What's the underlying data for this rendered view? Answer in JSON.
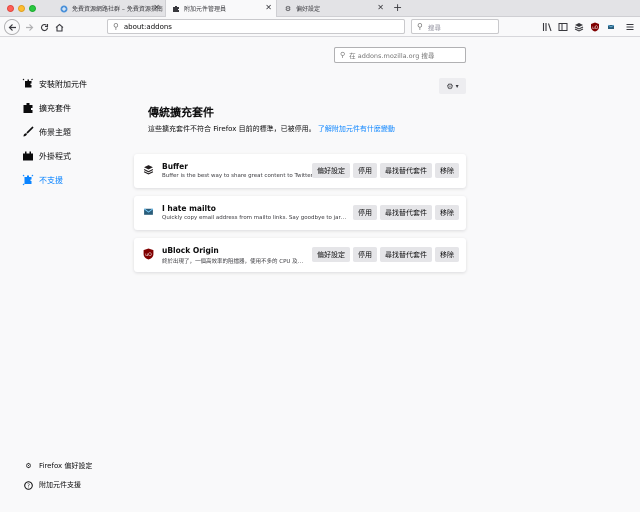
{
  "tabs": [
    {
      "label": "免費資源網路社群 – 免費資源指南",
      "active": false
    },
    {
      "label": "附加元件管理員",
      "active": true
    },
    {
      "label": "偏好設定",
      "active": false
    }
  ],
  "nav": {
    "url": "about:addons",
    "search_placeholder": "搜尋"
  },
  "amo_search_placeholder": "在 addons.mozilla.org 搜尋",
  "sidebar": {
    "items": [
      {
        "label": "安裝附加元件",
        "icon": "puzzle-sparkle-icon",
        "selected": false
      },
      {
        "label": "擴充套件",
        "icon": "puzzle-icon",
        "selected": false
      },
      {
        "label": "佈景主題",
        "icon": "brush-icon",
        "selected": false
      },
      {
        "label": "外掛程式",
        "icon": "plugin-block-icon",
        "selected": false
      },
      {
        "label": "不支援",
        "icon": "puzzle-unsupported-icon",
        "selected": true
      }
    ],
    "footer": [
      {
        "label": "Firefox 偏好設定",
        "icon": "gear-icon"
      },
      {
        "label": "附加元件支援",
        "icon": "help-icon"
      }
    ]
  },
  "main": {
    "heading": "傳統擴充套件",
    "notice": "這些擴充套件不符合 Firefox 目前的標準，已被停用。",
    "notice_link": "了解附加元件有什麼變動"
  },
  "extensions": [
    {
      "name": "Buffer",
      "description": "Buffer is the best way to share great content to Twitter, Facebook",
      "icon": "buffer-stack-icon",
      "buttons": [
        "偏好設定",
        "停用",
        "尋找替代套件",
        "移除"
      ]
    },
    {
      "name": "I hate mailto",
      "description": "Quickly copy email address from mailto links. Say goodbye to jarring mail clients",
      "icon": "mail-icon",
      "buttons": [
        "停用",
        "尋找替代套件",
        "移除"
      ]
    },
    {
      "name": "uBlock Origin",
      "description": "終於出現了，一個高效率的阻擋器，使用不多的 CPU 及記憶體。",
      "icon": "ublock-shield-icon",
      "buttons": [
        "偏好設定",
        "停用",
        "尋找替代套件",
        "移除"
      ]
    }
  ],
  "colors": {
    "accent": "#0a84ff",
    "ublock_red": "#800000"
  }
}
